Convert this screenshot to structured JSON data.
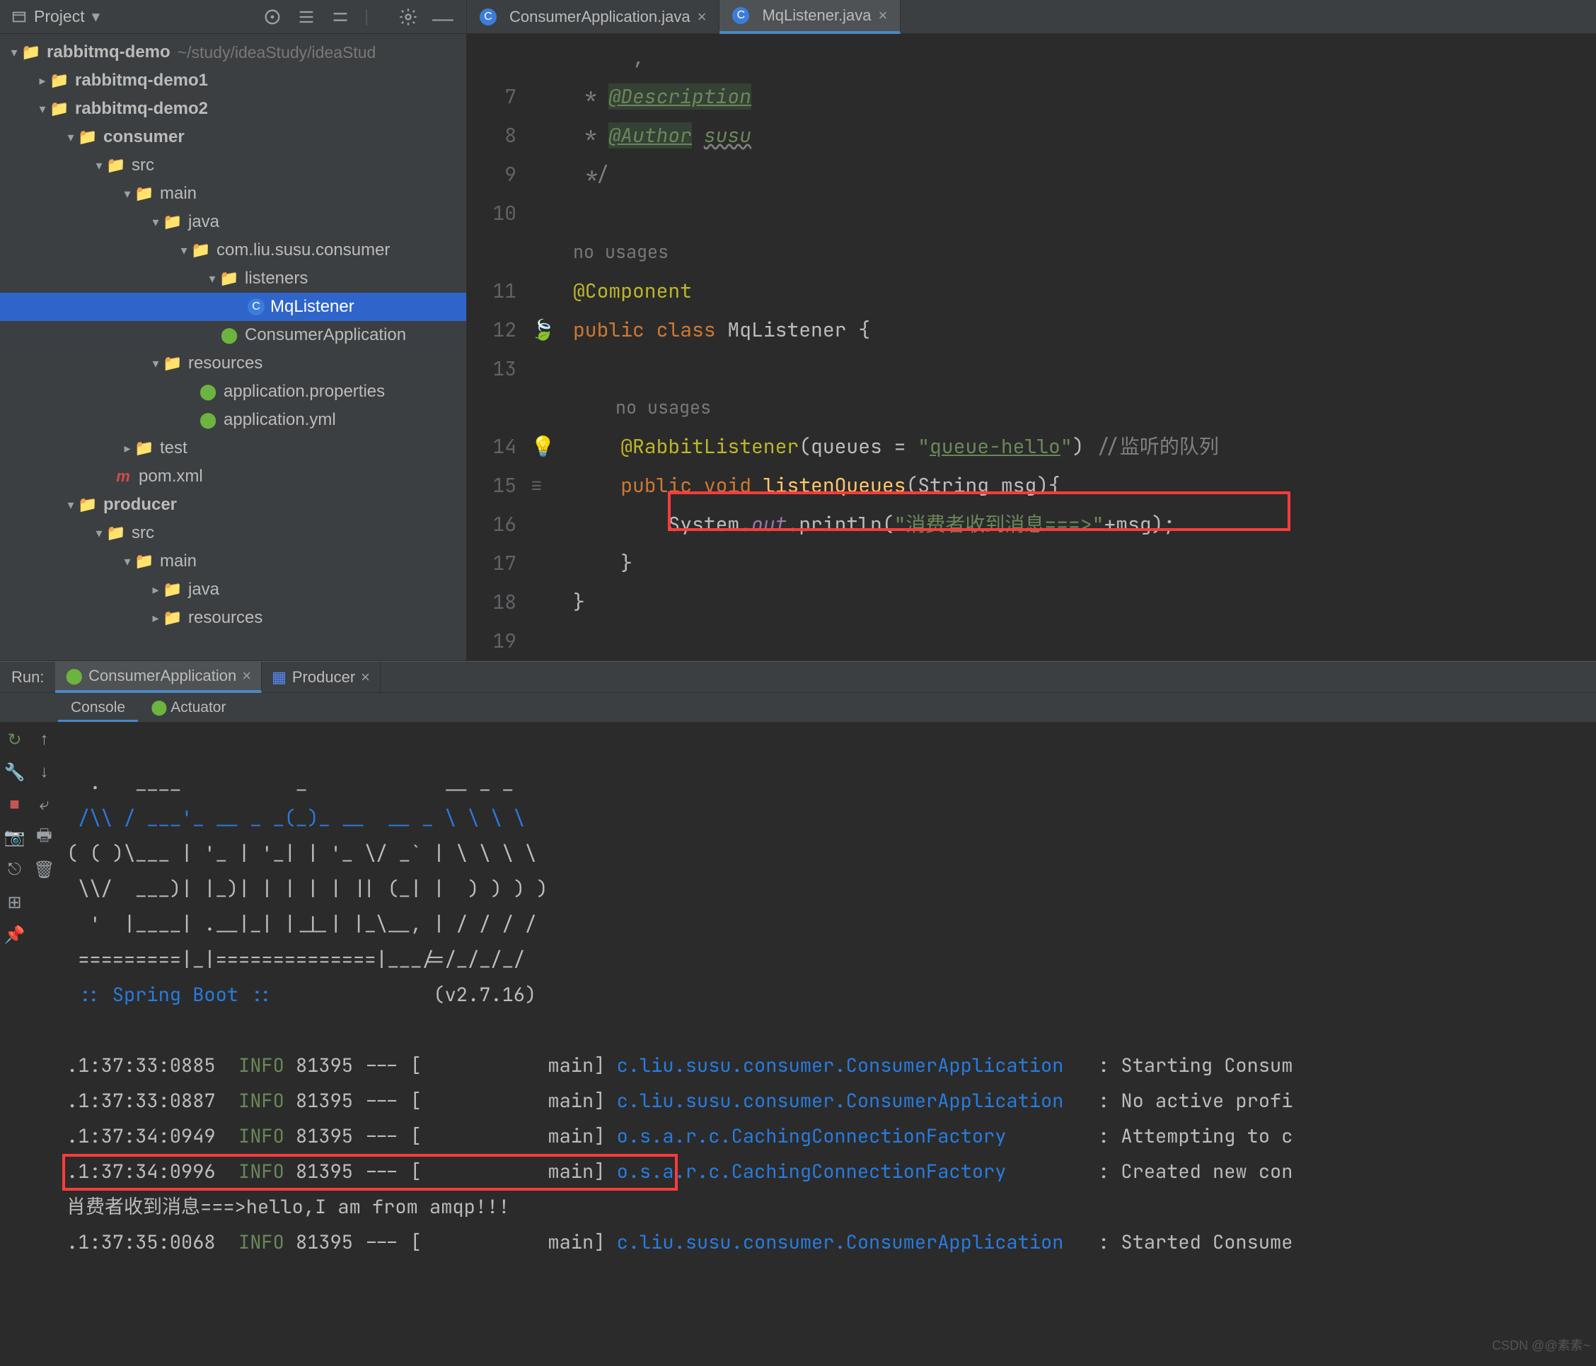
{
  "project_panel": {
    "title": "Project",
    "tree": {
      "root": {
        "name": "rabbitmq-demo",
        "path": "~/study/ideaStudy/ideaStud"
      },
      "demo1": "rabbitmq-demo1",
      "demo2": "rabbitmq-demo2",
      "consumer": "consumer",
      "src": "src",
      "main": "main",
      "java": "java",
      "pkg": "com.liu.susu.consumer",
      "listeners": "listeners",
      "mqlistener": "MqListener",
      "consumerapp": "ConsumerApplication",
      "resources": "resources",
      "app_props": "application.properties",
      "app_yml": "application.yml",
      "test": "test",
      "pom": "pom.xml",
      "producer": "producer",
      "p_src": "src",
      "p_main": "main",
      "p_java": "java",
      "p_resources": "resources"
    }
  },
  "editor_tabs": [
    {
      "label": "ConsumerApplication.java",
      "active": false
    },
    {
      "label": "MqListener.java",
      "active": true
    }
  ],
  "code": {
    "gutter": [
      "",
      "7",
      "8",
      "9",
      "10",
      "",
      "11",
      "12",
      "13",
      "",
      "14",
      "15",
      "16",
      "17",
      "18",
      "19"
    ],
    "lines": {
      "l7_star": " * ",
      "l7_tag": "@Description",
      "l8_star": " * ",
      "l8_tag": "@Author",
      "l8_val": "susu",
      "l9": " */",
      "l10": "",
      "hint1": "no usages",
      "l11": "@Component",
      "l12_pub": "public ",
      "l12_class": "class ",
      "l12_name": "MqListener {",
      "l13": "",
      "hint2": "no usages",
      "l14_ann": "@RabbitListener",
      "l14_open": "(queues = ",
      "l14_q1": "\"",
      "l14_qval": "queue-hello",
      "l14_q2": "\"",
      "l14_close": ") ",
      "l14_comment": "//监听的队列",
      "l15_pub": "public ",
      "l15_void": "void ",
      "l15_name": "listenQueues",
      "l15_args": "(String msg){",
      "l16_sys": "System.",
      "l16_out": "out",
      "l16_print": ".println(",
      "l16_str": "\"消费者收到消息===>\"",
      "l16_rest": "+msg);",
      "l17": "}",
      "l18": "}",
      "l19": ""
    }
  },
  "run": {
    "label": "Run:",
    "tabs": [
      {
        "label": "ConsumerApplication",
        "icon": "spring",
        "active": true
      },
      {
        "label": "Producer",
        "icon": "app",
        "active": false
      }
    ],
    "console_tabs": [
      {
        "label": "Console",
        "active": true
      },
      {
        "label": "Actuator",
        "active": false,
        "icon": "actuator"
      }
    ],
    "ascii": [
      "  .   ____          _            __ _ _",
      " /\\\\ / ___'_ __ _ _(_)_ __  __ _ \\ \\ \\ \\",
      "( ( )\\___ | '_ | '_| | '_ \\/ _` | \\ \\ \\ \\",
      " \\\\/  ___)| |_)| | | | | || (_| |  ) ) ) )",
      "  '  |____| .__|_| |_|_| |_\\__, | / / / /",
      " =========|_|==============|___/=/_/_/_/"
    ],
    "boot_line_a": " :: Spring Boot :: ",
    "boot_line_b": "             (v2.7.16)",
    "logs": [
      {
        "ts": "1:37:33:0885",
        "lvl": "INFO",
        "pid": "81395",
        "thread": "main",
        "cls": "c.liu.susu.consumer.ConsumerApplication",
        "msg": "Starting Consum"
      },
      {
        "ts": "1:37:33:0887",
        "lvl": "INFO",
        "pid": "81395",
        "thread": "main",
        "cls": "c.liu.susu.consumer.ConsumerApplication",
        "msg": "No active profi"
      },
      {
        "ts": "1:37:34:0949",
        "lvl": "INFO",
        "pid": "81395",
        "thread": "main",
        "cls": "o.s.a.r.c.CachingConnectionFactory",
        "msg": "Attempting to c"
      },
      {
        "ts": "1:37:34:0996",
        "lvl": "INFO",
        "pid": "81395",
        "thread": "main",
        "cls": "o.s.a.r.c.CachingConnectionFactory",
        "msg": "Created new con"
      }
    ],
    "highlighted_output": "肖费者收到消息===>hello,I am from amqp!!!",
    "last_log": {
      "ts": "1:37:35:0068",
      "lvl": "INFO",
      "pid": "81395",
      "thread": "main",
      "cls": "c.liu.susu.consumer.ConsumerApplication",
      "msg": "Started Consume"
    }
  },
  "watermark": "CSDN @@素素~"
}
